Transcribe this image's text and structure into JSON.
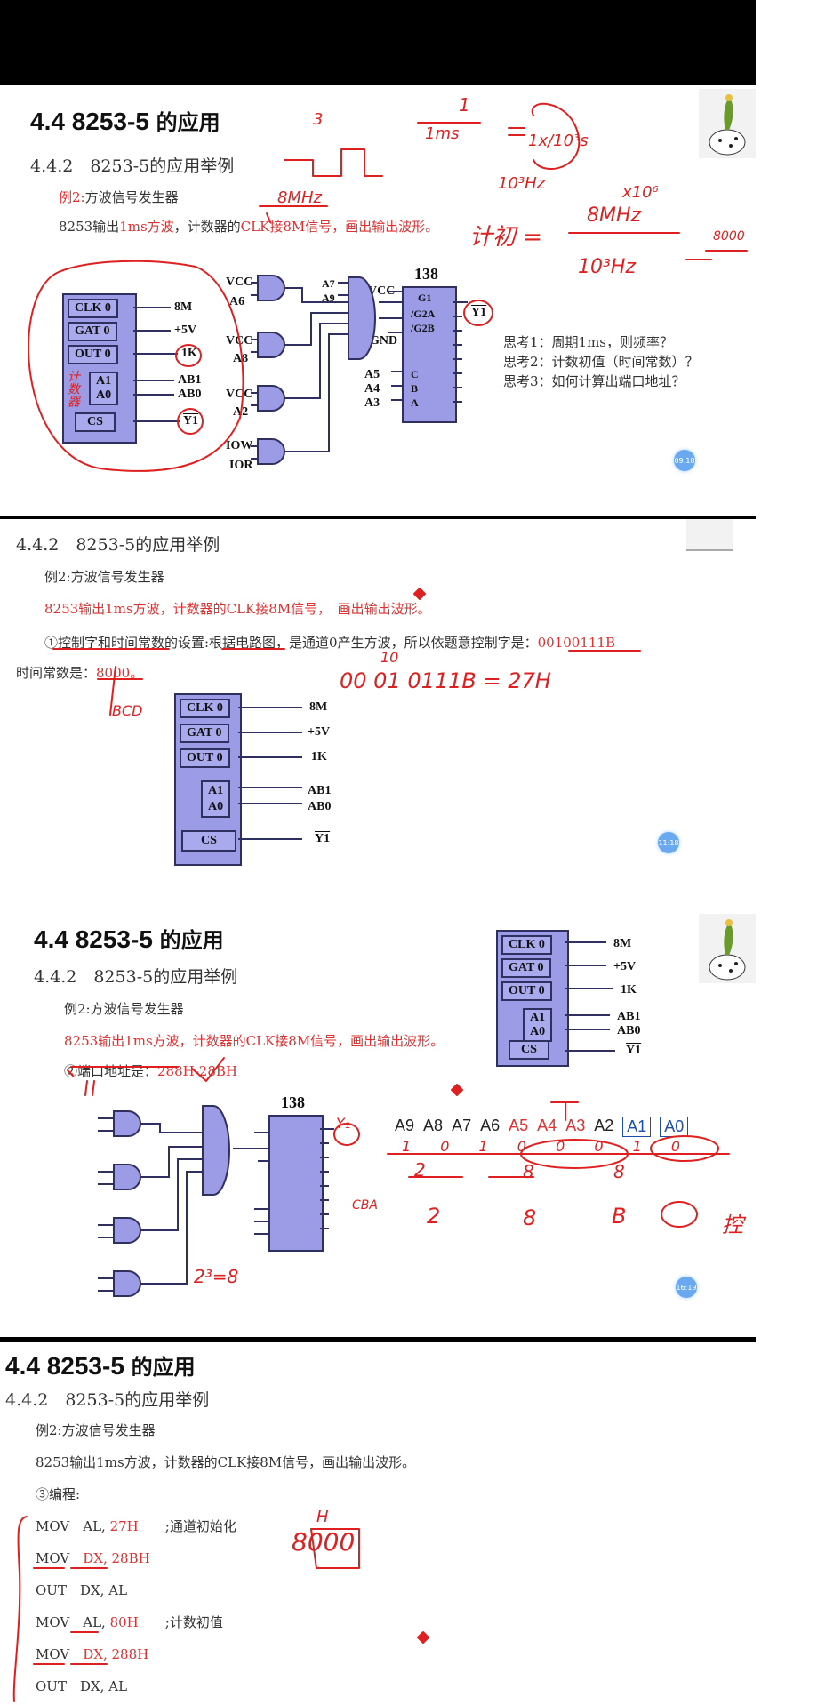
{
  "slide1": {
    "title_num": "4.4 8253-5",
    "title_cn": "的应用",
    "subtitle": "4.4.2　8253-5的应用举例",
    "example_prefix": "例2:",
    "example_title": "方波信号发生器",
    "task_a": "8253输出",
    "task_b": "1ms方波",
    "task_c": "，计数器的",
    "task_d": "CLK接8M信号",
    "task_e": "，画出输出波形。",
    "chip_pins": {
      "clk": "CLK 0",
      "gat": "GAT 0",
      "out": "OUT 0",
      "a1": "A1",
      "a0": "A0",
      "cs": "CS"
    },
    "chip_signals": {
      "clk": "8M",
      "gat": "+5V",
      "out": "1K",
      "a1": "AB1",
      "a0": "AB0",
      "cs": "Y1"
    },
    "decoder_label": "138",
    "decoder_pins": {
      "g1": "G1",
      "g2a": "/G2A",
      "g2b": "/G2B",
      "c": "C",
      "b": "B",
      "a": "A"
    },
    "gate_labels": {
      "vcc1": "VCC",
      "a6": "A6",
      "vcc2": "VCC",
      "a8": "A8",
      "vcc3": "VCC",
      "a2": "A2",
      "iow": "IOW",
      "ior": "IOR",
      "a7": "A7",
      "a9": "A9",
      "vcc4": "VCC",
      "gnd": "GND",
      "a5": "A5",
      "a4": "A4",
      "a3": "A3",
      "y1": "Y1"
    },
    "questions": [
      "思考1：周期1ms，则频率？",
      "思考2：计数初值（时间常数）？",
      "思考3：如何计算出端口地址？"
    ],
    "timestamp": "09:18",
    "handwriting": {
      "three": "3",
      "one": "1",
      "ims": "1ms",
      "frac": "1x/10³s",
      "hz": "10³Hz",
      "mhz": "8MHz",
      "x106": "x10⁶",
      "count": "计初 =",
      "eight_mhz": "8MHz",
      "ten3hz": "10³Hz",
      "eight_thousand": "8000",
      "counter_note": "计数器"
    }
  },
  "slide2": {
    "subtitle": "4.4.2　8253-5的应用举例",
    "example": "例2:方波信号发生器",
    "task": "8253输出1ms方波，计数器的CLK接8M信号，　画出输出波形。",
    "step1_a": "①控制字和时间常数的设置:根据电路图，是通道0产生方波，所以依题意控制字是：",
    "step1_ctrl": "00100111B",
    "step1_const_label": "时间常数是：",
    "step1_const": "8000",
    "step1_const_tail": "。",
    "chip_pins": {
      "clk": "CLK 0",
      "gat": "GAT 0",
      "out": "OUT 0",
      "a1": "A1",
      "a0": "A0",
      "cs": "CS"
    },
    "chip_signals": {
      "clk": "8M",
      "gat": "+5V",
      "out": "1K",
      "a1": "AB1",
      "a0": "AB0",
      "cs": "Y1"
    },
    "timestamp": "11:18",
    "handwriting": {
      "ten": "10",
      "binary": "00 01 0111B = 27H",
      "bcd": "BCD"
    }
  },
  "slide3": {
    "title_num": "4.4 8253-5",
    "title_cn": "的应用",
    "subtitle": "4.4.2　8253-5的应用举例",
    "example": "例2:方波信号发生器",
    "task": "8253输出1ms方波，计数器的CLK接8M信号，画出输出波形。",
    "step2_label": "②端口地址是：",
    "step2_value": "288H-28BH",
    "address_bits": [
      {
        "name": "A9",
        "color": "#222"
      },
      {
        "name": "A8",
        "color": "#222"
      },
      {
        "name": "A7",
        "color": "#222"
      },
      {
        "name": "A6",
        "color": "#222"
      },
      {
        "name": "A5",
        "color": "#e03030"
      },
      {
        "name": "A4",
        "color": "#e03030"
      },
      {
        "name": "A3",
        "color": "#e03030"
      },
      {
        "name": "A2",
        "color": "#222"
      },
      {
        "name": "A1",
        "color": "#1a4fb0"
      },
      {
        "name": "A0",
        "color": "#1a4fb0"
      }
    ],
    "chip_pins": {
      "clk": "CLK 0",
      "gat": "GAT 0",
      "out": "OUT 0",
      "a1": "A1",
      "a0": "A0",
      "cs": "CS"
    },
    "chip_signals": {
      "clk": "8M",
      "gat": "+5V",
      "out": "1K",
      "a1": "AB1",
      "a0": "AB0",
      "cs": "Y1"
    },
    "decoder_label": "138",
    "timestamp": "16:19",
    "handwriting": {
      "bits": "1 0 1 0 0 0 1 0",
      "two": "2",
      "eight1": "8",
      "eight2": "8",
      "tail": "0 0 0",
      "h1": "2",
      "h2": "8",
      "h3": "B",
      "kong": "控",
      "pow": "2³=8",
      "cba": "CBA",
      "y1": "Y₁"
    }
  },
  "slide4": {
    "title_num": "4.4 8253-5",
    "title_cn": "的应用",
    "subtitle": "4.4.2　8253-5的应用举例",
    "example": "例2:方波信号发生器",
    "task": "8253输出1ms方波，计数器的CLK接8M信号，画出输出波形。",
    "step3": "③编程:",
    "code": [
      {
        "op": "MOV",
        "arg1": "AL,",
        "arg2": "27H",
        "comment": ";通道初始化"
      },
      {
        "op": "MOV",
        "arg1": "DX,",
        "arg2": "28BH",
        "comment": ""
      },
      {
        "op": "OUT",
        "arg1": "DX,",
        "arg2": "AL",
        "comment": ""
      },
      {
        "op": "MOV",
        "arg1": "AL,",
        "arg2": "80H",
        "comment": ";计数初值"
      },
      {
        "op": "MOV",
        "arg1": "DX,",
        "arg2": "288H",
        "comment": ""
      },
      {
        "op": "OUT",
        "arg1": "DX,",
        "arg2": "AL",
        "comment": ""
      }
    ],
    "handwriting": {
      "h": "H",
      "val": "8000"
    }
  }
}
